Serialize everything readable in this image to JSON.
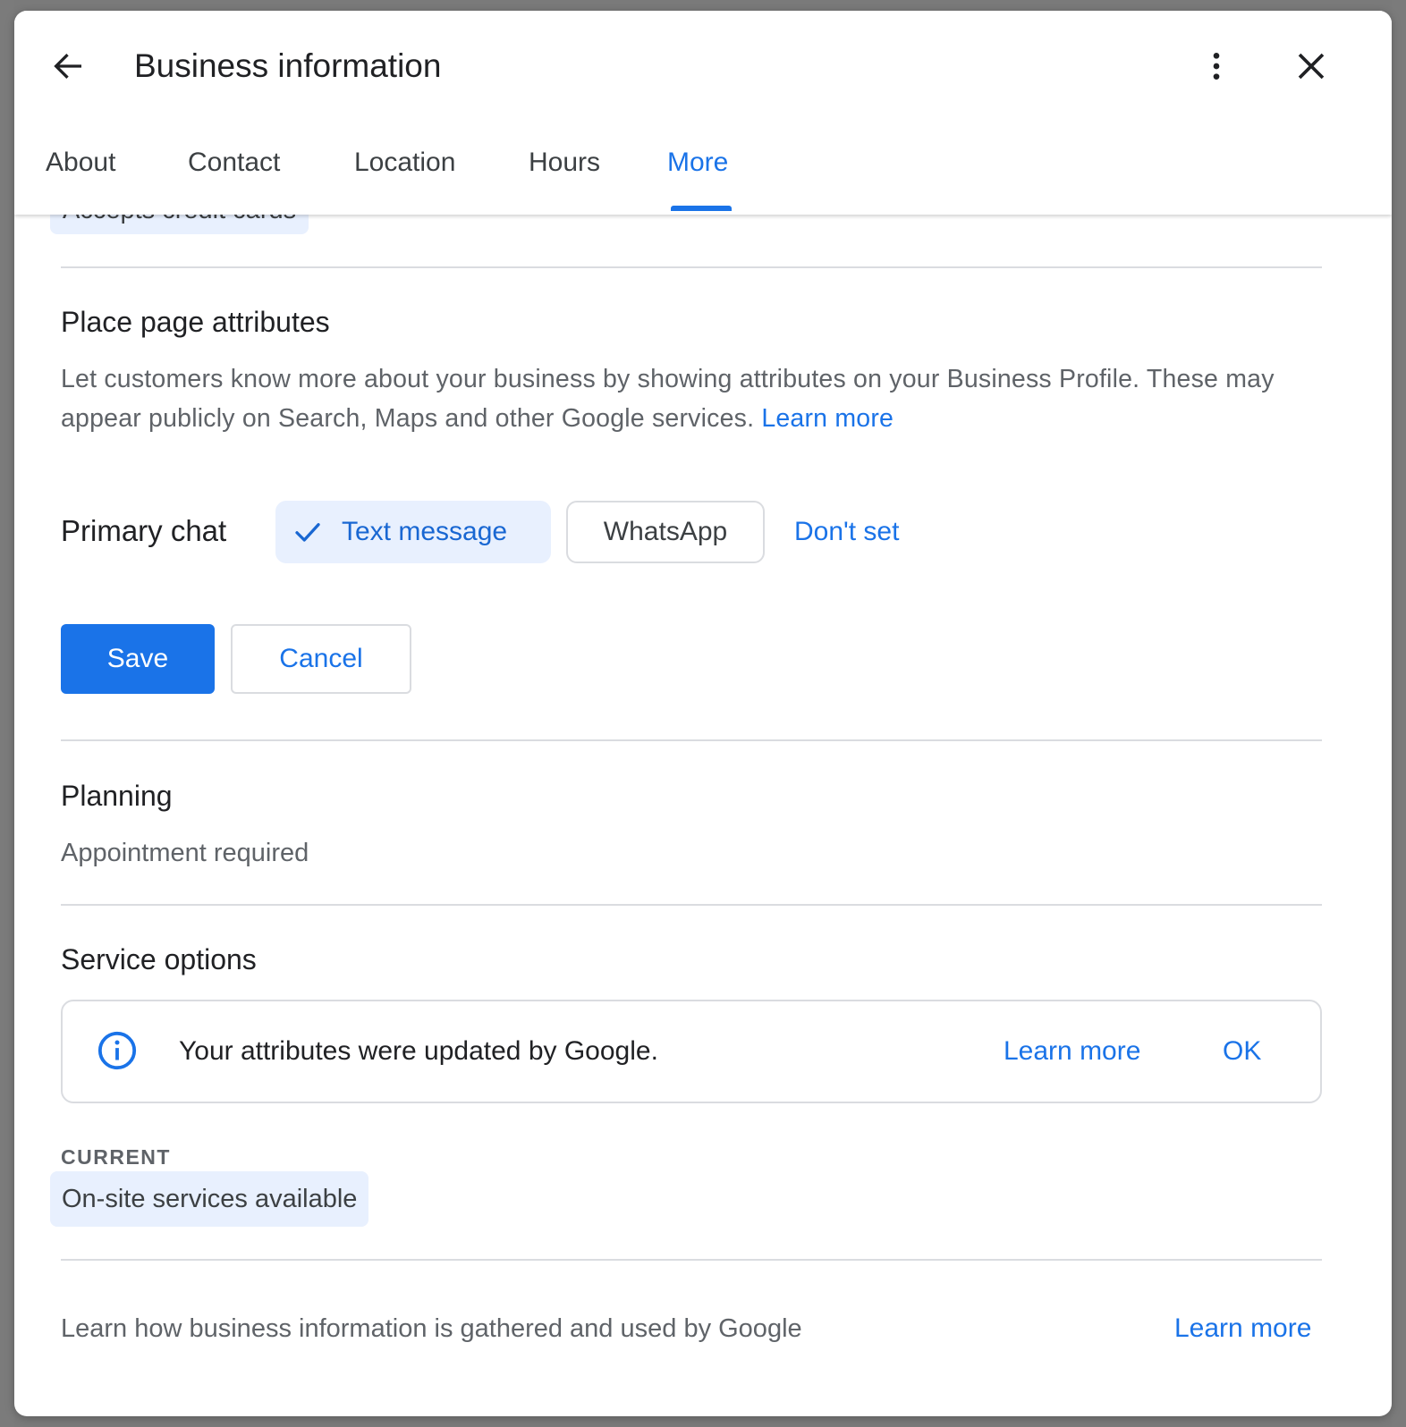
{
  "dialog": {
    "title": "Business information",
    "tabs": [
      {
        "label": "About",
        "active": false
      },
      {
        "label": "Contact",
        "active": false
      },
      {
        "label": "Location",
        "active": false
      },
      {
        "label": "Hours",
        "active": false
      },
      {
        "label": "More",
        "active": true
      }
    ]
  },
  "partial_chip": "Accepts credit cards",
  "place_page_attributes": {
    "title": "Place page attributes",
    "description": "Let customers know more about your business by showing attributes on your Business Profile. These may appear publicly on Search, Maps and other Google services.",
    "learn_more": "Learn more",
    "primary_chat": {
      "label": "Primary chat",
      "options": [
        "Text message",
        "WhatsApp"
      ],
      "selected": "Text message",
      "dont_set": "Don't set"
    },
    "save": "Save",
    "cancel": "Cancel"
  },
  "planning": {
    "title": "Planning",
    "value": "Appointment required"
  },
  "service_options": {
    "title": "Service options",
    "notice": {
      "text": "Your attributes were updated by Google.",
      "learn_more": "Learn more",
      "ok": "OK"
    },
    "current_label": "CURRENT",
    "current_value": "On-site services available"
  },
  "footer": {
    "text": "Learn how business information is gathered and used by Google",
    "learn_more": "Learn more"
  },
  "colors": {
    "accent": "#1a73e8",
    "chip_bg": "#e8f0fe",
    "divider": "#dadce0",
    "secondary_text": "#5f6368"
  },
  "icons": {
    "back": "arrow-back-icon",
    "menu": "more-vert-icon",
    "close": "close-icon",
    "check": "check-icon",
    "info": "info-icon"
  }
}
